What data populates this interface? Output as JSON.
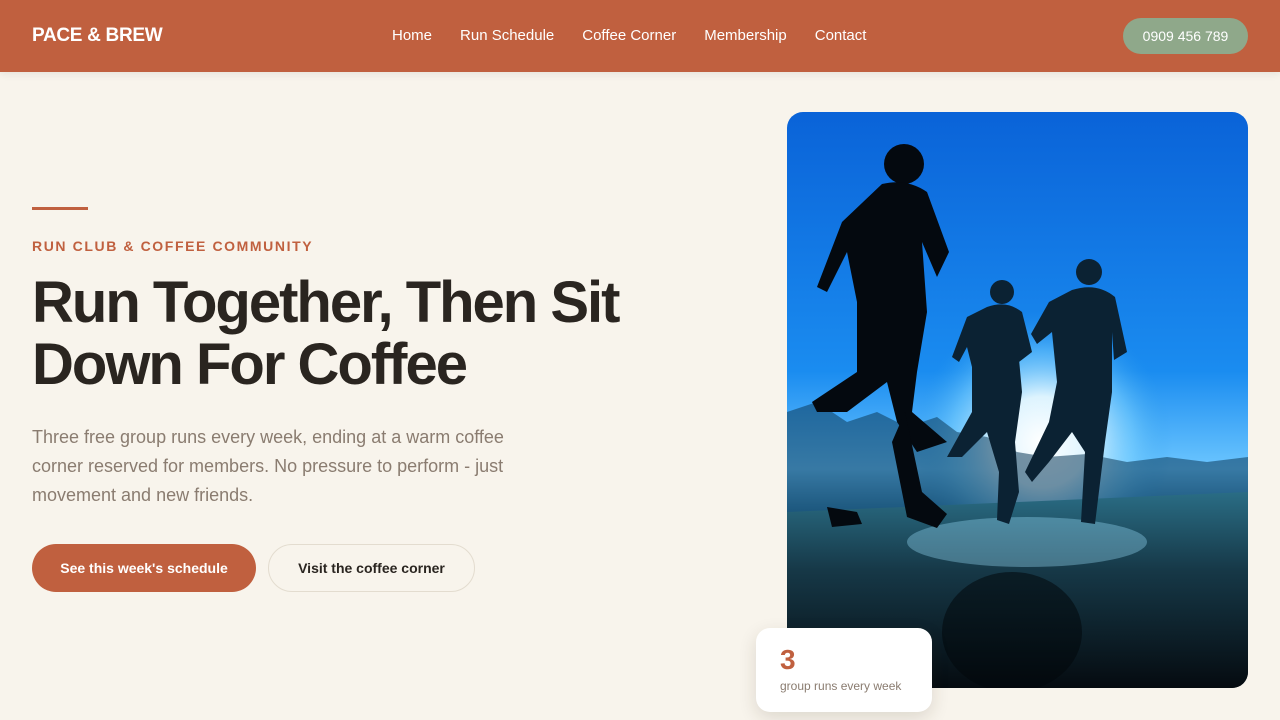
{
  "header": {
    "logo": "PACE & BREW",
    "nav": [
      "Home",
      "Run Schedule",
      "Coffee Corner",
      "Membership",
      "Contact"
    ],
    "phone": "0909 456 789"
  },
  "hero": {
    "eyebrow": "RUN CLUB & COFFEE COMMUNITY",
    "title_line1": "Run Together, Then Sit",
    "title_line2": "Down For Coffee",
    "description": "Three free group runs every week, ending at a warm coffee corner reserved for members. No pressure to perform - just movement and new friends.",
    "primary_button": "See this week's schedule",
    "secondary_button": "Visit the coffee corner"
  },
  "stat_card": {
    "number": "3",
    "label": "group runs every week"
  },
  "colors": {
    "brand": "#c0603f",
    "accent_green": "#8fa88a",
    "background": "#f8f4ec",
    "text_dark": "#2a2520",
    "text_muted": "#8a7c70"
  }
}
